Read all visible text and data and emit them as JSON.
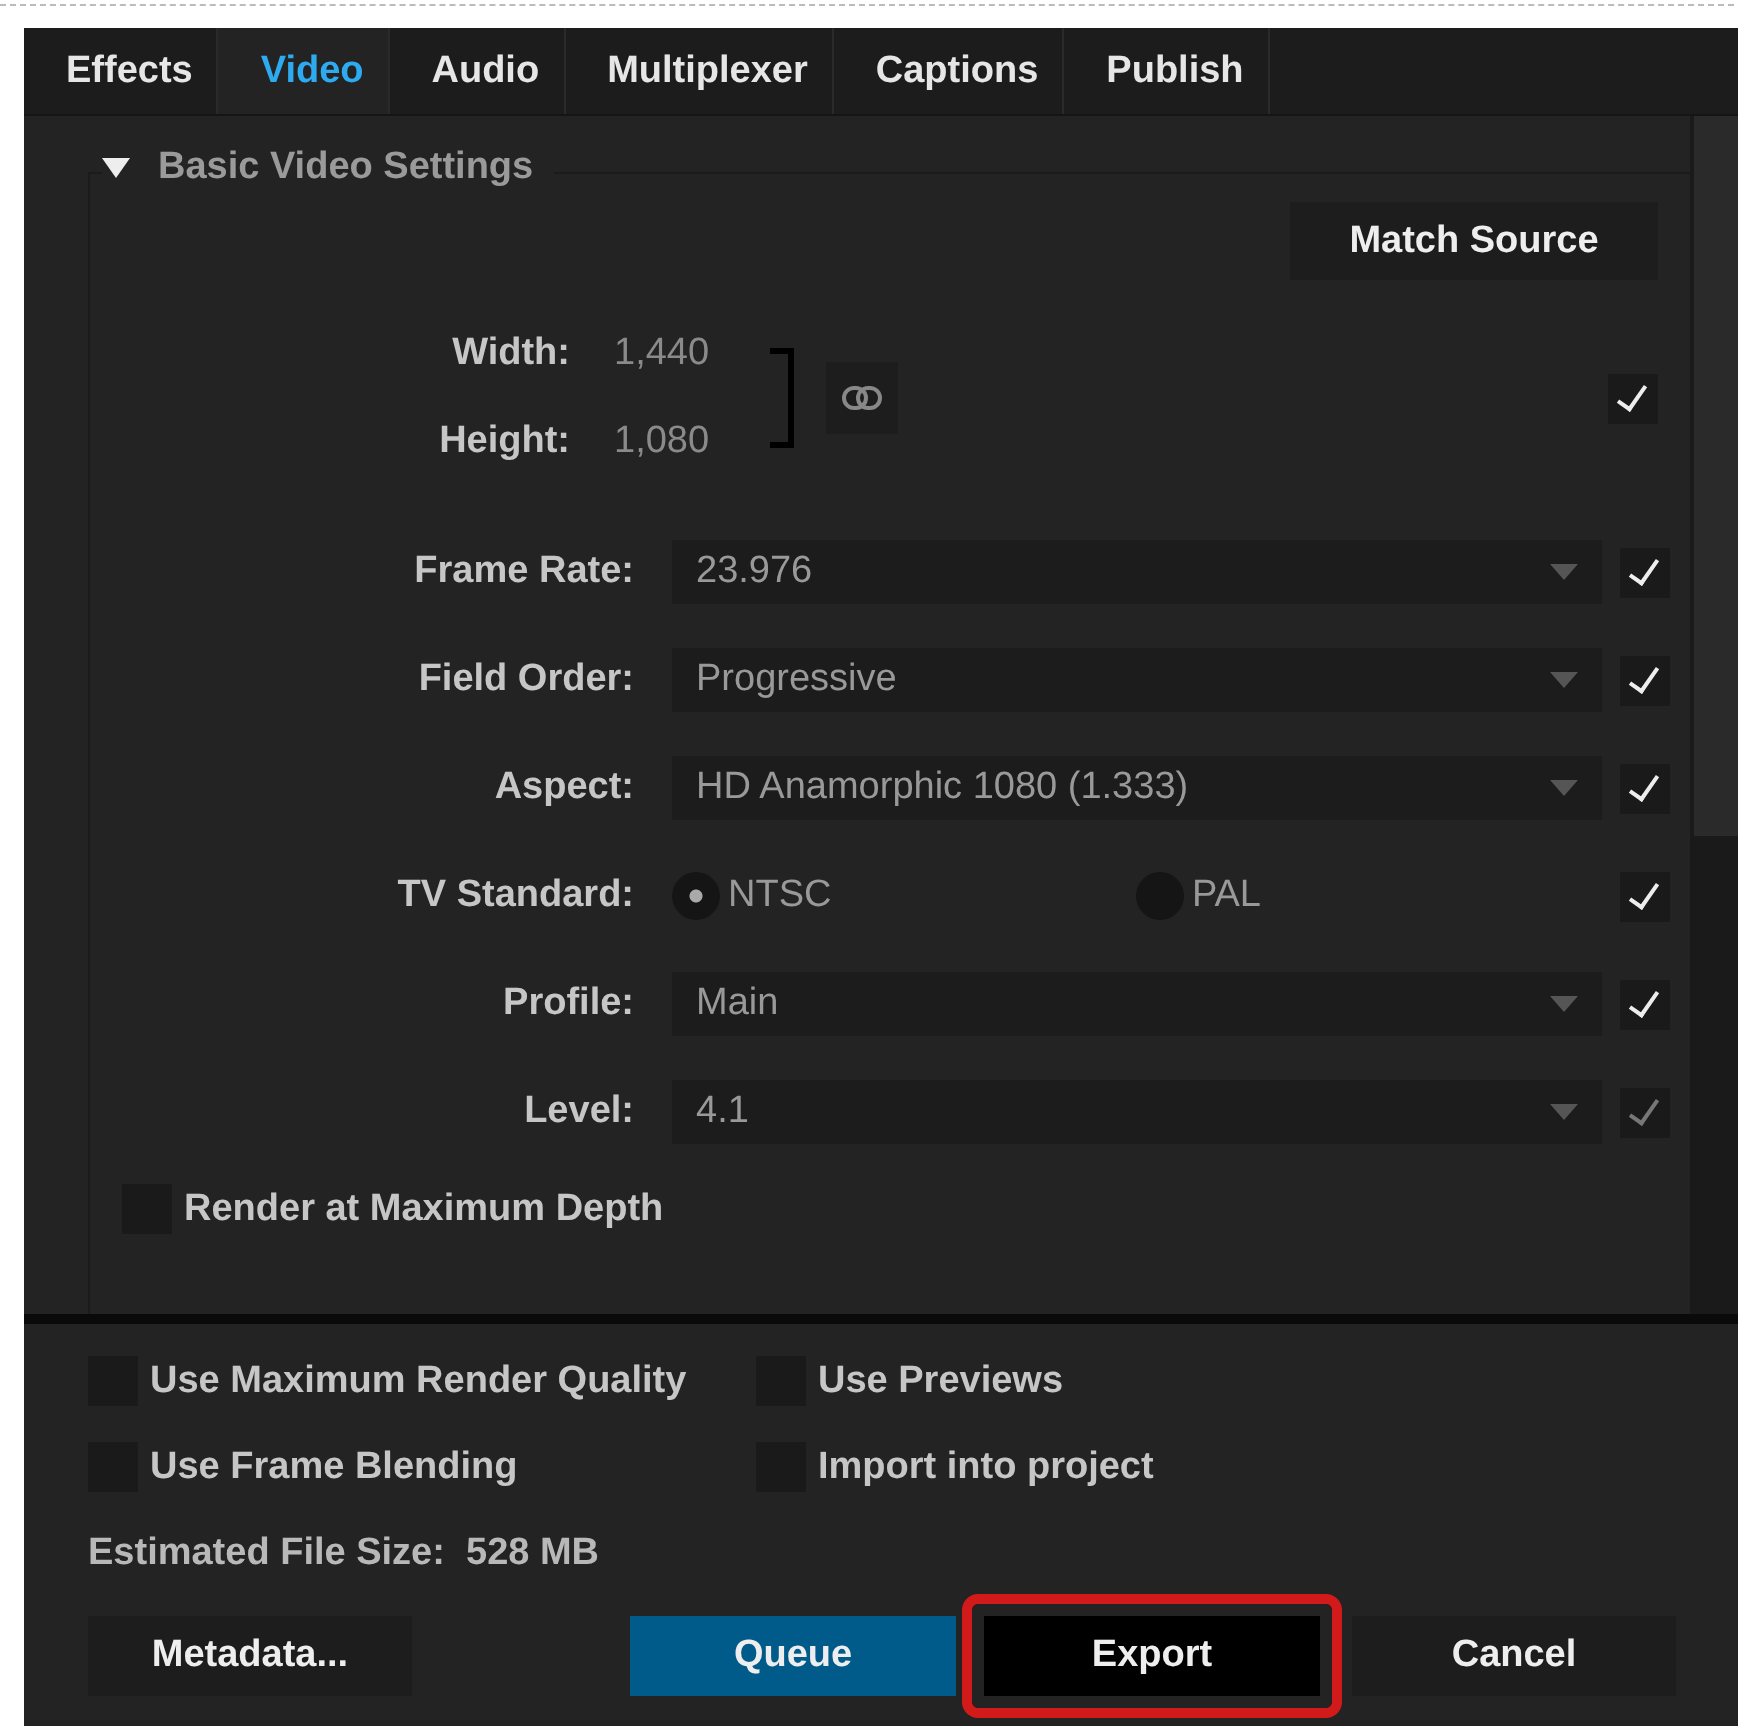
{
  "tabs": [
    {
      "label": "Effects",
      "selected": false
    },
    {
      "label": "Video",
      "selected": true
    },
    {
      "label": "Audio",
      "selected": false
    },
    {
      "label": "Multiplexer",
      "selected": false
    },
    {
      "label": "Captions",
      "selected": false
    },
    {
      "label": "Publish",
      "selected": false
    }
  ],
  "section": {
    "title": "Basic Video Settings",
    "expanded": true
  },
  "match_source_button": "Match Source",
  "dimensions": {
    "width_label": "Width:",
    "width_value": "1,440",
    "height_label": "Height:",
    "height_value": "1,080",
    "checked": true
  },
  "fields": [
    {
      "kind": "dropdown",
      "label": "Frame Rate:",
      "value": "23.976",
      "checked": true,
      "disabled": false
    },
    {
      "kind": "dropdown",
      "label": "Field Order:",
      "value": "Progressive",
      "checked": true,
      "disabled": false
    },
    {
      "kind": "dropdown",
      "label": "Aspect:",
      "value": "HD Anamorphic 1080 (1.333)",
      "checked": true,
      "disabled": false
    },
    {
      "kind": "radio",
      "label": "TV Standard:",
      "options": [
        {
          "label": "NTSC",
          "selected": true
        },
        {
          "label": "PAL",
          "selected": false
        }
      ],
      "checked": true,
      "disabled": false
    },
    {
      "kind": "dropdown",
      "label": "Profile:",
      "value": "Main",
      "checked": true,
      "disabled": false
    },
    {
      "kind": "dropdown",
      "label": "Level:",
      "value": "4.1",
      "checked": true,
      "disabled": true
    }
  ],
  "render_max_depth": {
    "label": "Render at Maximum Depth",
    "checked": false
  },
  "options": [
    {
      "label": "Use Maximum Render Quality",
      "checked": false
    },
    {
      "label": "Use Previews",
      "checked": false
    },
    {
      "label": "Use Frame Blending",
      "checked": false
    },
    {
      "label": "Import into project",
      "checked": false
    }
  ],
  "estimated_size": "Estimated File Size:  528 MB",
  "buttons": [
    {
      "kind": "plain",
      "label": "Metadata...",
      "highlighted": false
    },
    {
      "kind": "primary",
      "label": "Queue",
      "highlighted": false
    },
    {
      "kind": "dark",
      "label": "Export",
      "highlighted": true
    },
    {
      "kind": "plain",
      "label": "Cancel",
      "highlighted": false
    }
  ]
}
